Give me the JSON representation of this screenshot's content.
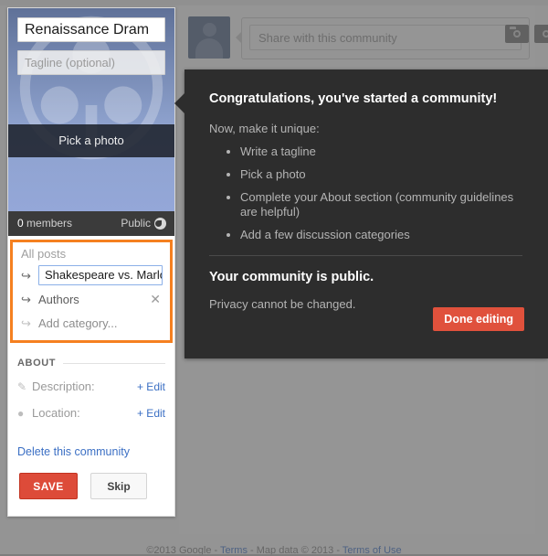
{
  "sidebar": {
    "community_name": "Renaissance Dram",
    "tagline_placeholder": "Tagline (optional)",
    "pick_photo_label": "Pick a photo",
    "members_count": "0",
    "members_label": "members",
    "privacy_label": "Public",
    "privacy_icon": "globe-icon",
    "categories": {
      "all_posts_label": "All posts",
      "editing_value": "Shakespeare vs. Marlow",
      "items": [
        {
          "label": "Authors",
          "remove_icon": "close-icon"
        }
      ],
      "add_label": "Add category...",
      "arrow_icon": "arrow-curve-icon",
      "highlight_color": "#f58020"
    },
    "about": {
      "heading": "ABOUT",
      "rows": [
        {
          "icon": "pencil-icon",
          "label": "Description:",
          "action": "+ Edit"
        },
        {
          "icon": "location-pin-icon",
          "label": "Location:",
          "action": "+ Edit"
        }
      ]
    },
    "delete_link": "Delete this community",
    "save_label": "SAVE",
    "skip_label": "Skip",
    "save_color": "#dd4b39"
  },
  "share": {
    "placeholder": "Share with this community",
    "avatar_icon": "user-avatar-icon",
    "camera_icon": "camera-icon",
    "second_icon": "circle-icon"
  },
  "modal": {
    "title": "Congratulations, you've started a community!",
    "subtitle": "Now, make it unique:",
    "checklist": [
      "Write a tagline",
      "Pick a photo",
      "Complete your About section (community guidelines are helpful)",
      "Add a few discussion categories"
    ],
    "privacy_heading": "Your community is public.",
    "privacy_note": "Privacy cannot be changed.",
    "done_label": "Done editing",
    "done_color": "#e0513c"
  },
  "footer": {
    "copyright": "©2013 Google  -  ",
    "terms": "Terms",
    "mapdata": "  -  Map data © 2013 - ",
    "terms_of_use": "Terms of Use"
  }
}
